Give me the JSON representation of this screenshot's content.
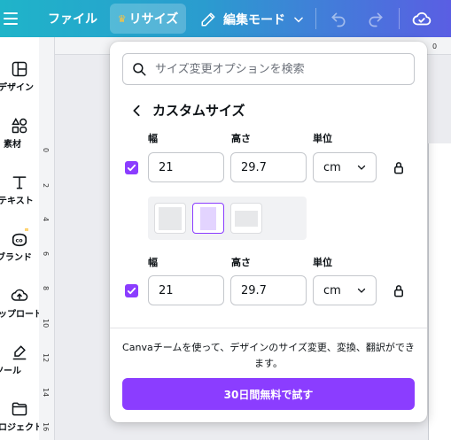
{
  "topbar": {
    "file_label": "ファイル",
    "resize_label": "リサイズ",
    "edit_mode_label": "編集モード"
  },
  "sidebar": {
    "items": [
      {
        "label": "デザイン",
        "icon": "layout-icon"
      },
      {
        "label": "素材",
        "icon": "shapes-icon"
      },
      {
        "label": "テキスト",
        "icon": "text-icon"
      },
      {
        "label": "ブランド",
        "icon": "brand-icon"
      },
      {
        "label": "アップロード",
        "icon": "upload-icon"
      },
      {
        "label": "ツール",
        "icon": "draw-icon"
      },
      {
        "label": "プロジェクト",
        "icon": "folder-icon"
      }
    ]
  },
  "rulers": {
    "vertical": [
      "0",
      "2",
      "4",
      "6",
      "8",
      "10",
      "12",
      "14",
      "16"
    ],
    "horizontal": [
      "0"
    ]
  },
  "panel": {
    "search_placeholder": "サイズ変更オプションを検索",
    "title": "カスタムサイズ",
    "row1": {
      "width_label": "幅",
      "height_label": "高さ",
      "unit_label": "単位",
      "width": "21",
      "height": "29.7",
      "unit": "cm",
      "checked": true
    },
    "row2": {
      "width_label": "幅",
      "height_label": "高さ",
      "unit_label": "単位",
      "width": "21",
      "height": "29.7",
      "unit": "cm",
      "checked": true
    },
    "promo_text": "Canvaチームを使って、デザインのサイズ変更、変換、翻訳ができます。",
    "cta_label": "30日間無料で試す"
  },
  "colors": {
    "accent": "#8b3dff",
    "topbar_start": "#1fb4c9",
    "topbar_end": "#5a5ee3",
    "crown": "#ffc43d"
  }
}
